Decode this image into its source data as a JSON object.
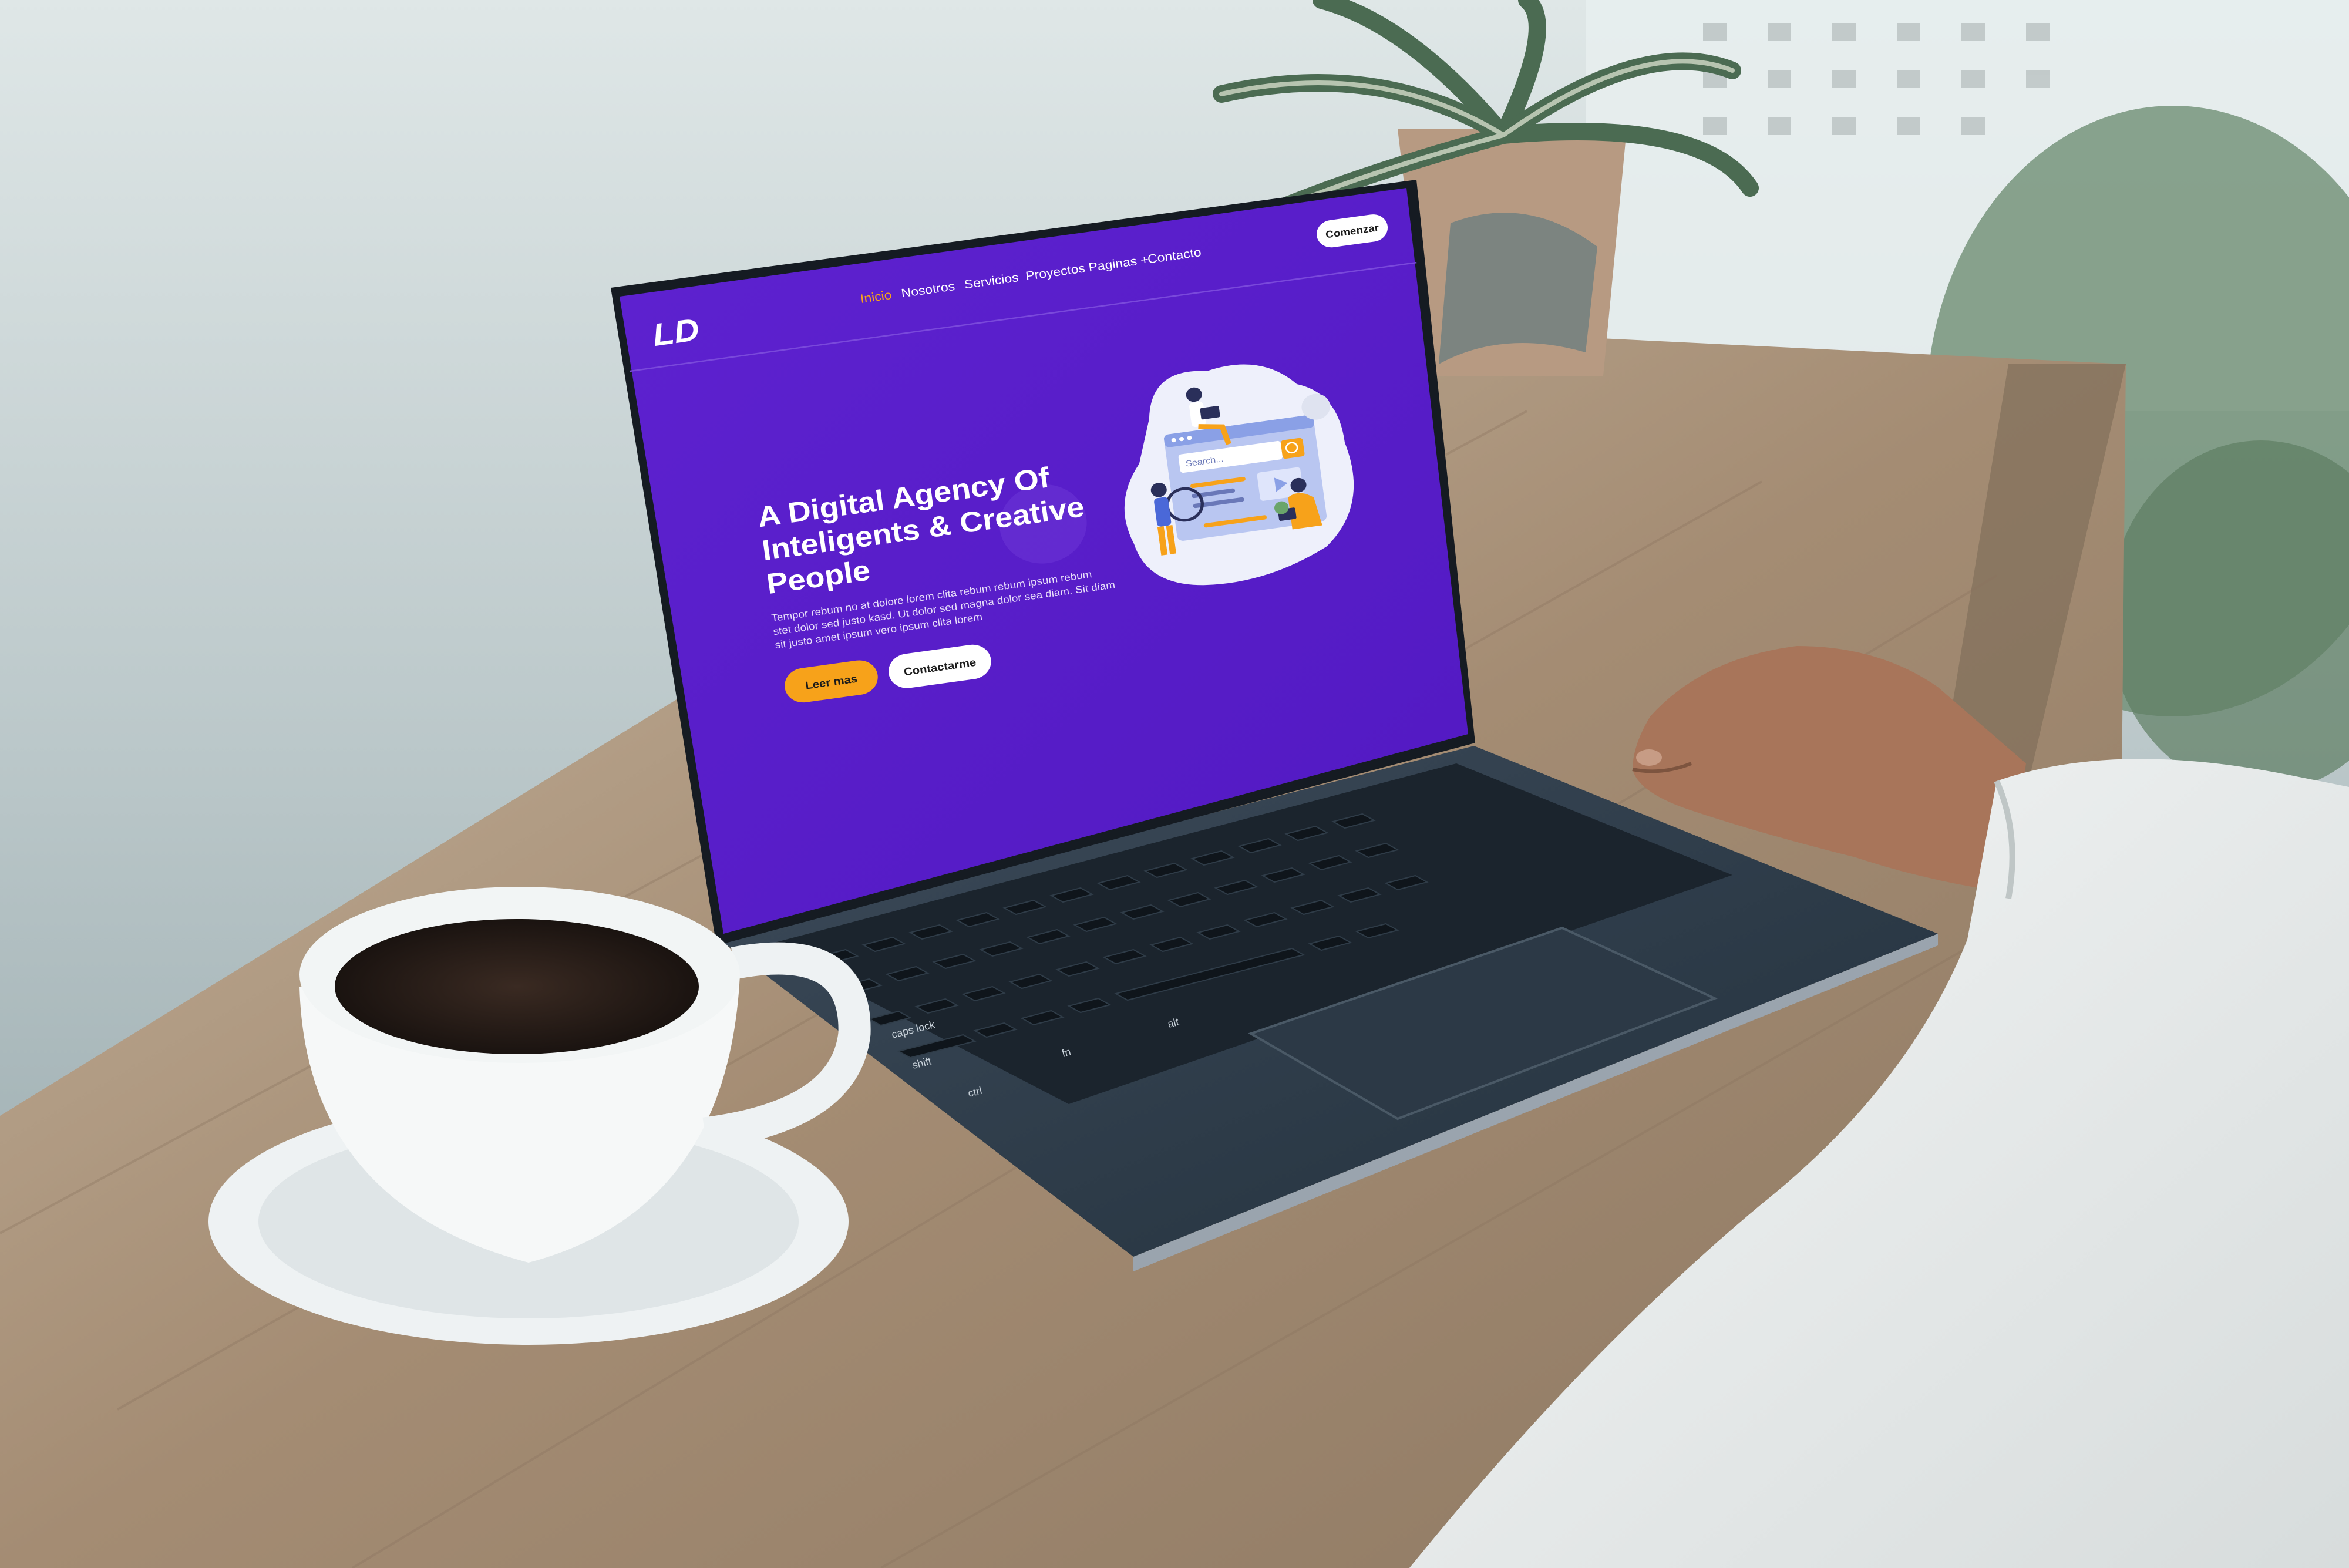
{
  "colors": {
    "brand_purple": "#5b20cc",
    "accent_orange": "#f7a21a",
    "nav_active": "#f7a21a",
    "button_white": "#ffffff",
    "table_wood": "#a08a72"
  },
  "site": {
    "logo": "LD",
    "nav": {
      "items": [
        "Inicio",
        "Nosotros",
        "Servicios",
        "Proyectos",
        "Paginas +",
        "Contacto"
      ],
      "active_index": 0,
      "cta": "Comenzar"
    },
    "hero": {
      "title_lines": [
        "A Digital Agency Of",
        "Inteligents & Creative",
        "People"
      ],
      "body_lines": [
        "Tempor rebum no at dolore lorem clita rebum rebum ipsum rebum",
        "stet dolor sed justo kasd. Ut dolor sed magna dolor sea diam. Sit diam",
        "sit justo amet ipsum vero ipsum clita lorem"
      ],
      "primary_button": "Leer mas",
      "secondary_button": "Contactarme",
      "illustration_search": "Search..."
    }
  },
  "keyboard": {
    "labels": [
      "caps lock",
      "shift",
      "ctrl",
      "fn",
      "alt"
    ]
  }
}
